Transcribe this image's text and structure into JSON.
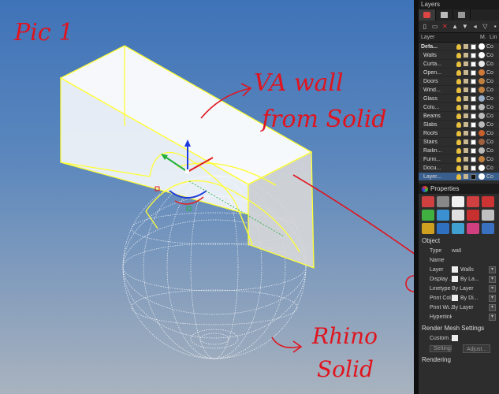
{
  "annotations": {
    "pic_label": "Pic 1",
    "va_wall_line1": "VA wall",
    "va_wall_line2": "from Solid",
    "rhino_line1": "Rhino",
    "rhino_line2": "Solid"
  },
  "layers_panel": {
    "title": "Layers",
    "columns": {
      "layer": "Layer",
      "material": "M.",
      "linetype": "Lin"
    },
    "rows": [
      {
        "name": "Defa...",
        "color": "#ffffff",
        "material": "#ffffff",
        "linetype": "Co",
        "selected": false
      },
      {
        "name": "Walls",
        "color": "#ffffff",
        "material": "#ffffff",
        "linetype": "Co",
        "selected": false
      },
      {
        "name": "Curta...",
        "color": "#ffffff",
        "material": "#e8e8e8",
        "linetype": "Co",
        "selected": false
      },
      {
        "name": "Open...",
        "color": "#ffffff",
        "material": "#d07a3a",
        "linetype": "Co",
        "selected": false
      },
      {
        "name": "Doors",
        "color": "#ffffff",
        "material": "#c08040",
        "linetype": "Co",
        "selected": false
      },
      {
        "name": "Wind...",
        "color": "#ffffff",
        "material": "#c08040",
        "linetype": "Co",
        "selected": false
      },
      {
        "name": "Glass",
        "color": "#ffffff",
        "material": "#9ab0c8",
        "linetype": "Co",
        "selected": false
      },
      {
        "name": "Colu...",
        "color": "#ffffff",
        "material": "#bbbbbb",
        "linetype": "Co",
        "selected": false
      },
      {
        "name": "Beams",
        "color": "#ffffff",
        "material": "#bbbbbb",
        "linetype": "Co",
        "selected": false
      },
      {
        "name": "Slabs",
        "color": "#ffffff",
        "material": "#bbbbbb",
        "linetype": "Co",
        "selected": false
      },
      {
        "name": "Roofs",
        "color": "#ffffff",
        "material": "#c8602c",
        "linetype": "Co",
        "selected": false
      },
      {
        "name": "Stairs",
        "color": "#ffffff",
        "material": "#a06040",
        "linetype": "Co",
        "selected": false
      },
      {
        "name": "Railin...",
        "color": "#ffffff",
        "material": "#bbbbbb",
        "linetype": "Co",
        "selected": false
      },
      {
        "name": "Furni...",
        "color": "#ffffff",
        "material": "#c08040",
        "linetype": "Co",
        "selected": false
      },
      {
        "name": "Docu...",
        "color": "#ffffff",
        "material": "#ffffff",
        "linetype": "Co",
        "selected": false
      },
      {
        "name": "Layer...",
        "color": "#111111",
        "material": "#ffffff",
        "linetype": "Co",
        "selected": true
      }
    ]
  },
  "properties_panel": {
    "title": "Properties",
    "icon_colors": [
      "#d04040",
      "#888888",
      "#f0f0f0",
      "#d04040",
      "#cc3333",
      "#40b040",
      "#3a90d0",
      "#e0e0e0",
      "#c83030",
      "#c0c0c0",
      "#d0a020",
      "#3070c0",
      "#40a0d0",
      "#d04080",
      "#3a70c0"
    ],
    "object_section": "Object",
    "fields": [
      {
        "label": "Type",
        "value": "wall",
        "swatch": false,
        "dropdown": false
      },
      {
        "label": "Name",
        "value": "",
        "swatch": false,
        "dropdown": false
      },
      {
        "label": "Layer",
        "value": "Walls",
        "swatch": true,
        "dropdown": true
      },
      {
        "label": "Display ...",
        "value": "By La...",
        "swatch": true,
        "dropdown": true
      },
      {
        "label": "Linetype",
        "value": "By Layer",
        "swatch": false,
        "dropdown": true
      },
      {
        "label": "Print Col...",
        "value": "By Di...",
        "swatch": true,
        "dropdown": true
      },
      {
        "label": "Print Wi...",
        "value": "By Layer",
        "swatch": false,
        "dropdown": true
      },
      {
        "label": "Hyperlink",
        "value": "",
        "swatch": false,
        "dropdown": true
      }
    ],
    "render_mesh_section": "Render Mesh Settings",
    "custom_label": "Custom ...",
    "settings_label": "Settings",
    "adjust_label": "Adjust...",
    "rendering_section": "Rendering"
  },
  "colors": {
    "solid_outline": "#ffff33",
    "annotation": "#e0141e",
    "selected_row": "#3b5f8c"
  }
}
